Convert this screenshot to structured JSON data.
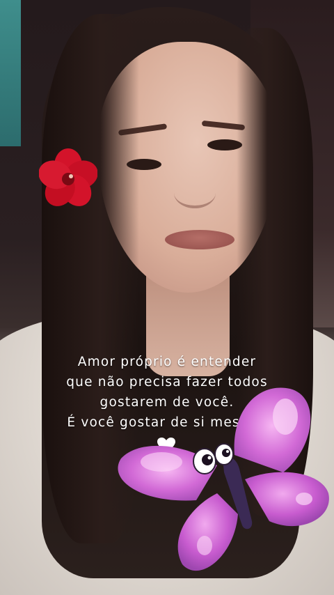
{
  "quote": {
    "lines": [
      "Amor próprio é entender",
      "que não precisa fazer todos",
      "gostarem de você.",
      "É você gostar de si mesma."
    ]
  },
  "icons": {
    "heart": "heart-icon",
    "butterfly": "butterfly-sticker",
    "flower": "hibiscus-flower"
  },
  "colors": {
    "text": "#ffffff",
    "butterfly": "#d26ad6",
    "flower": "#d3132a"
  }
}
